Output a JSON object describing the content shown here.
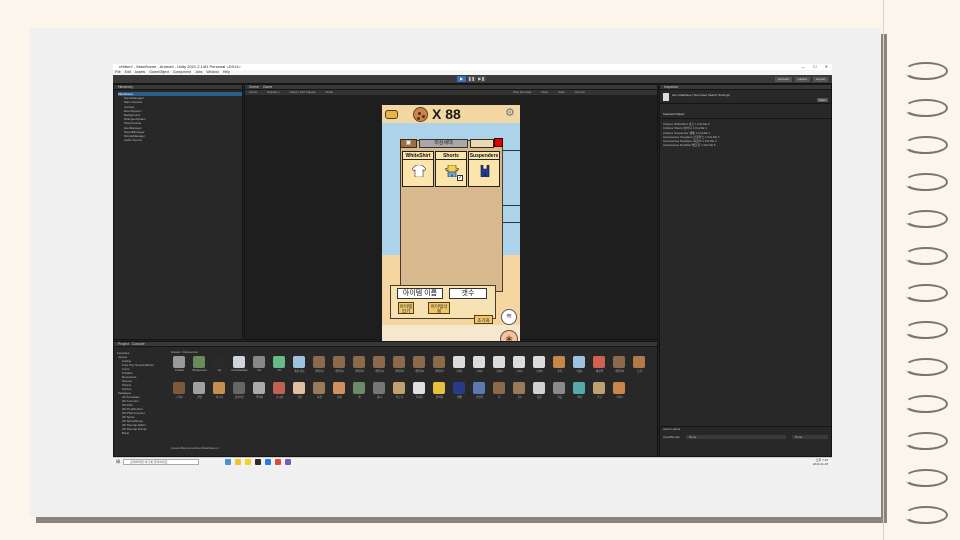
{
  "window": {
    "title": "cNiber2 - MainScene - Android - Unity 2021.2.14f1 Personal <DX11>",
    "controls": [
      "—",
      "☐",
      "✕"
    ]
  },
  "menu": [
    "File",
    "Edit",
    "Assets",
    "GameObject",
    "Component",
    "Jobs",
    "Window",
    "Help"
  ],
  "toolbar": {
    "play": "▶",
    "pause": "❚❚",
    "step": "▶❚",
    "right": [
      "Account",
      "Layers",
      "Layout"
    ]
  },
  "hierarchy": {
    "tab": "Hierarchy",
    "items": [
      "MainScene",
      "GameManager",
      "Main Camera",
      "Canvas",
      "EventSystem",
      "Background",
      "DialogueSystem",
      "ShopCanvas",
      "ItemManager",
      "SoundManager",
      "SimpleManager",
      "Audio Source"
    ]
  },
  "scene": {
    "tabs": [
      "Scene",
      "Game"
    ],
    "game_bar": [
      "Game",
      "Display 1",
      "Galaxy S10 Square",
      "Scale",
      "Play Focused",
      "Mute",
      "Stats",
      "Gizmos"
    ]
  },
  "game": {
    "cookie_count": "X 88",
    "tab_middle": "의상세대",
    "items": [
      "WhiteShirt",
      "Shorts",
      "Suspenders"
    ],
    "check_mark": "✓",
    "item_name_label": "아이템 이름",
    "count_label": "갯수",
    "btn_buy": "아이템\n얻기",
    "btn_sell": "아이템삭\n제",
    "btn_reset": "초기화",
    "wave_icon": "≋",
    "paw_icon": "❀"
  },
  "inspector": {
    "tab": "Inspector",
    "title": "Item Database (Test Asset Search Settings)",
    "open": "Open",
    "section": "Imported Object",
    "rows": [
      "Clothes  WhiteShirt    셔츠    1    FALSE  0",
      "Clothes  Shorts    반바지    1    FALSE  1",
      "Clothes  Suspender    멜빵    1    FALSE  2",
      "Accessories  Sunglass    선글라스    1    FALSE  3",
      "Accessories  Necklace    목걸이    1    FALSE  4",
      "Accessories  Redshirt    빨간옷    1    FALSE  5"
    ],
    "asset_labels": "Asset Labels",
    "asset_bundle": "AssetBundle",
    "none": "None"
  },
  "project": {
    "tabs": [
      "Project",
      "Console"
    ],
    "favorites": "Favorites",
    "folders": [
      "Assets",
      "Audios",
      "Free Pop Sound Effects",
      "Fonts",
      "Prefabs",
      "Resources",
      "Scenes",
      "Scripts",
      "Sprites",
      "Packages",
      "2D Animation",
      "2D Common",
      "2D Path",
      "2D PixelPerfect",
      "2D PSD Importer",
      "2D Sprite",
      "2D SpriteShape",
      "2D Tilemap Editor",
      "2D Tilemap Extras",
      "Burst"
    ],
    "breadcrumb": "Assets > Resources",
    "path": "Assets/Resources/ItemDatabase.txt",
    "assets": [
      {
        "label": "Prefabs",
        "color": "#9a9a9a"
      },
      {
        "label": "Background",
        "color": "#6a8c5a"
      },
      {
        "label": "Aa",
        "color": "#2a2a2a"
      },
      {
        "label": "ItemDatabase",
        "color": "#cfd4de"
      },
      {
        "label": "bar",
        "color": "#888"
      },
      {
        "label": "btn",
        "color": "#6b8"
      },
      {
        "label": "배경 하늘",
        "color": "#9cc4de"
      },
      {
        "label": "캐릭터1",
        "color": "#8a6a4a"
      },
      {
        "label": "캐릭터2",
        "color": "#8a6a4a"
      },
      {
        "label": "캐릭터3",
        "color": "#8a6a4a"
      },
      {
        "label": "캐릭터4",
        "color": "#8a6a4a"
      },
      {
        "label": "캐릭터5",
        "color": "#8a6a4a"
      },
      {
        "label": "캐릭터6",
        "color": "#8a6a4a"
      },
      {
        "label": "캐릭터7",
        "color": "#8a6a4a"
      },
      {
        "label": "냥이1",
        "color": "#dcdcdc"
      },
      {
        "label": "냥이2",
        "color": "#dcdcdc"
      },
      {
        "label": "냥이3",
        "color": "#dcdcdc"
      },
      {
        "label": "냥이4",
        "color": "#dcdcdc"
      },
      {
        "label": "냥이5",
        "color": "#dcdcdc"
      },
      {
        "label": "쿠키",
        "color": "#c8874a"
      },
      {
        "label": "의상1",
        "color": "#9cc4de"
      },
      {
        "label": "배경색",
        "color": "#d06050"
      },
      {
        "label": "캐릭터8",
        "color": "#8a6a4a"
      },
      {
        "label": "모자",
        "color": "#b07a4a"
      },
      {
        "label": "모자2",
        "color": "#7a5a3a"
      },
      {
        "label": "가방",
        "color": "#a0a0a0"
      },
      {
        "label": "바구니",
        "color": "#c89050"
      },
      {
        "label": "선글라스",
        "color": "#666"
      },
      {
        "label": "넥타이",
        "color": "#aaa"
      },
      {
        "label": "소시지",
        "color": "#c06050"
      },
      {
        "label": "신발",
        "color": "#e0c0a0"
      },
      {
        "label": "장갑",
        "color": "#9a7a5a"
      },
      {
        "label": "물통",
        "color": "#d09060"
      },
      {
        "label": "캔",
        "color": "#6a8a6a"
      },
      {
        "label": "톱니",
        "color": "#777"
      },
      {
        "label": "목도리",
        "color": "#c0a070"
      },
      {
        "label": "티셔츠",
        "color": "#e0e0e0"
      },
      {
        "label": "반바지",
        "color": "#e8c040"
      },
      {
        "label": "멜빵",
        "color": "#2a3a8a"
      },
      {
        "label": "수영복",
        "color": "#5a7ab0"
      },
      {
        "label": "문",
        "color": "#8a6a4a"
      },
      {
        "label": "문2",
        "color": "#9a7a5a"
      },
      {
        "label": "창문",
        "color": "#d0d0d0"
      },
      {
        "label": "기둥",
        "color": "#8a8a8a"
      },
      {
        "label": "액자",
        "color": "#5aa"
      },
      {
        "label": "가구",
        "color": "#c0a070"
      },
      {
        "label": "쿠키2",
        "color": "#c8874a"
      }
    ]
  },
  "taskbar": {
    "search": "검색하려면 여기에 입력하세요.",
    "time": "오후 7:32",
    "date": "2023-11-18"
  }
}
